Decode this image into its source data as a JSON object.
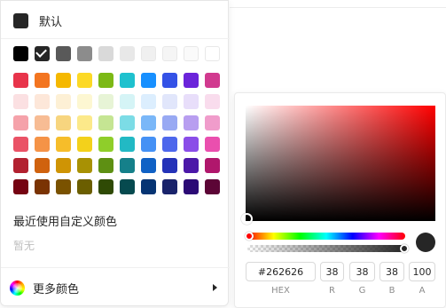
{
  "palette": {
    "default_label": "默认",
    "default_color": "#262626",
    "rows": [
      [
        "#000000",
        "#262626",
        "#595959",
        "#8c8c8c",
        "#d9d9d9",
        "#e8e8e8",
        "#f0f0f0",
        "#f5f5f5",
        "#fafafa",
        "#ffffff"
      ],
      [
        "#e8344b",
        "#f37520",
        "#f5b800",
        "#fcd926",
        "#7cb916",
        "#1fc1ce",
        "#1890ff",
        "#3452e6",
        "#6b24da",
        "#d13a8f"
      ],
      [
        "#fbe0e2",
        "#fde7d9",
        "#fdf0d5",
        "#fdf7d2",
        "#e7f4d6",
        "#d5f4f6",
        "#dceefe",
        "#e1e6fb",
        "#e8defa",
        "#f9dced"
      ],
      [
        "#f5a2aa",
        "#f7bc94",
        "#f7d57f",
        "#fce98a",
        "#c5e593",
        "#7cdce6",
        "#7ab7f8",
        "#98a9f3",
        "#b89ef0",
        "#f09ccb"
      ],
      [
        "#ea5266",
        "#f59347",
        "#f6bd2a",
        "#f3d11b",
        "#8fce2a",
        "#22b9c4",
        "#4591f5",
        "#4d67ec",
        "#8a4de8",
        "#ea4fae"
      ],
      [
        "#b22130",
        "#d0620e",
        "#cf9404",
        "#a89104",
        "#5e9013",
        "#15808a",
        "#1061c5",
        "#2432b8",
        "#4b18a8",
        "#b0176c"
      ],
      [
        "#750312",
        "#7a3303",
        "#7a5200",
        "#6b5e00",
        "#2f4a05",
        "#064a4f",
        "#063473",
        "#19236b",
        "#2b0a75",
        "#5c0536"
      ]
    ],
    "selected_color": "#262626",
    "recent_title": "最近使用自定义颜色",
    "recent_empty": "暂无",
    "more_label": "更多颜色"
  },
  "picker": {
    "hex": "#262626",
    "r": "38",
    "g": "38",
    "b": "38",
    "a": "100",
    "labels": {
      "hex": "HEX",
      "r": "R",
      "g": "G",
      "b": "B",
      "a": "A"
    },
    "hue_color": "#ff0000",
    "current_color": "#262626"
  }
}
